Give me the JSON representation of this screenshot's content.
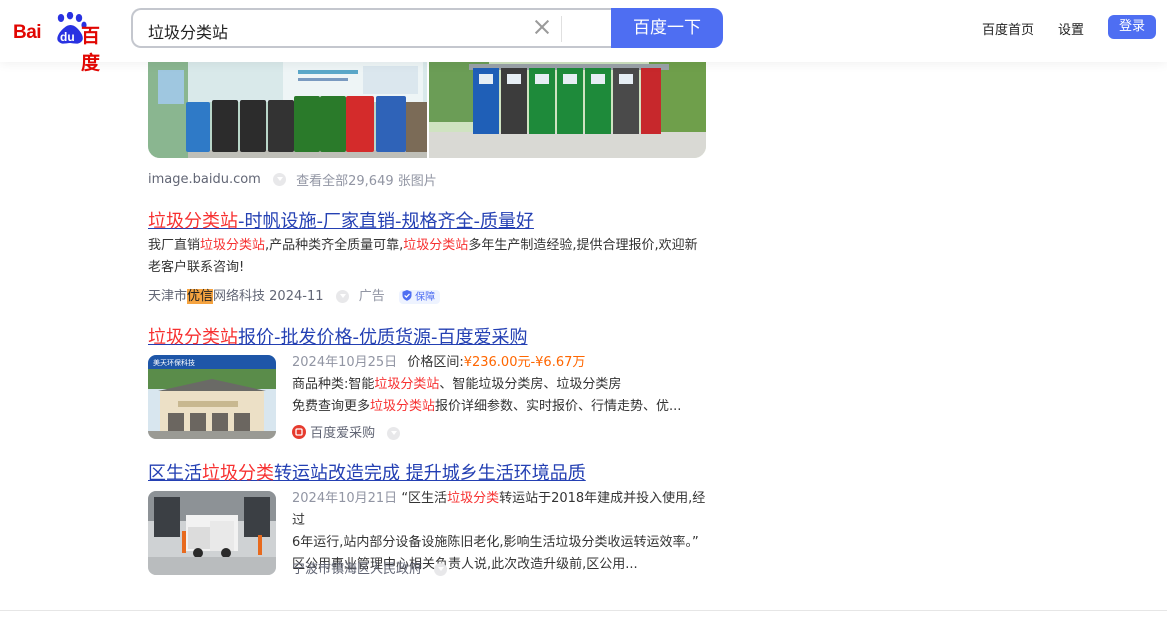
{
  "header": {
    "logo_bai": "Bai",
    "logo_du": "du",
    "logo_cn": "百度",
    "query": "垃圾分类站",
    "search_button": "百度一下",
    "links": [
      "百度首页",
      "设置"
    ],
    "login": "登录"
  },
  "image_result": {
    "source": "image.baidu.com",
    "view_all": "查看全部29,649 张图片"
  },
  "result1": {
    "title_hl": "垃圾分类站",
    "title_rest": "-时帆设施-厂家直销-规格齐全-质量好",
    "desc_1": "我厂直销",
    "desc_hl1": "垃圾分类站",
    "desc_2": ",产品种类齐全质量可靠,",
    "desc_hl2": "垃圾分类站",
    "desc_3": "多年生产制造经验,提供合理报价,欢迎新",
    "desc_4": "老客户联系咨询!",
    "source_a": "天津市",
    "source_hl": "优信",
    "source_b": "网络科技 2024-11",
    "ad": "广告",
    "badge": "保障"
  },
  "result2": {
    "title_hl": "垃圾分类站",
    "title_rest": "报价-批发价格-优质货源-百度爱采购",
    "date": "2024年10月25日",
    "price_label": "价格区间:",
    "price": "¥236.00元-¥6.67万",
    "line2_a": "商品种类:智能",
    "line2_hl": "垃圾分类站",
    "line2_b": "、智能垃圾分类房、垃圾分类房",
    "line3_a": "免费查询更多",
    "line3_hl": "垃圾分类站",
    "line3_b": "报价详细参数、实时报价、行情走势、优...",
    "source": "百度爱采购",
    "thumb_text": "美天环保科技"
  },
  "result3": {
    "title_a": "区生活",
    "title_hl": "垃圾分类",
    "title_b": "转运站改造完成 提升城乡生活环境品质",
    "date": "2024年10月21日",
    "line1_a": "“区生活",
    "line1_hl": "垃圾分类",
    "line1_b": "转运站于2018年建成并投入使用,经过",
    "line2": "6年运行,站内部分设备设施陈旧老化,影响生活垃圾分类收运转运效率。”",
    "line3": "区公用事业管理中心相关负责人说,此次改造升级前,区公用...",
    "source": "宁波市镇海区人民政府"
  },
  "colors": {
    "accent": "#4e6ef2",
    "link": "#2440b3",
    "highlight": "#f73131",
    "price": "#ff6600",
    "logo_red": "#e10602",
    "logo_blue": "#2932e1"
  }
}
